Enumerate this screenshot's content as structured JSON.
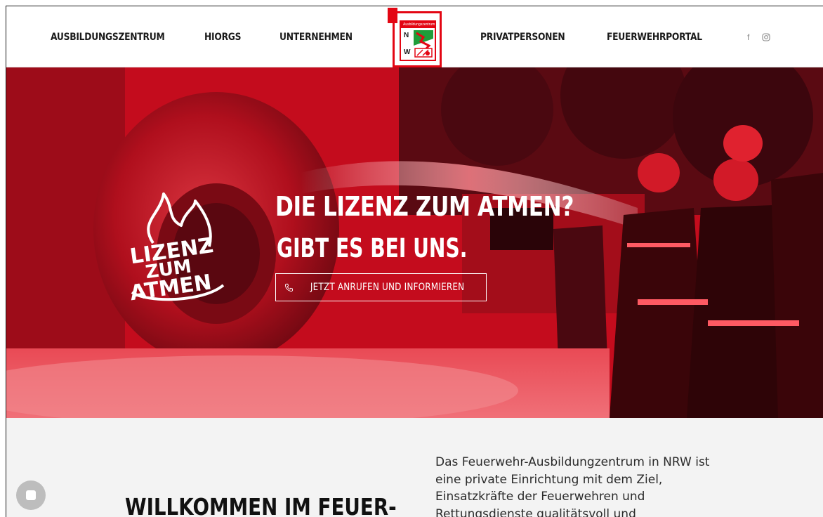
{
  "nav": {
    "left": [
      "AUSBILDUNGSZENTRUM",
      "HIORGS",
      "UNTERNEHMEN"
    ],
    "right": [
      "PRIVATPERSONEN",
      "FEUERWEHRPORTAL"
    ]
  },
  "logo": {
    "top_text": "Ausbildungszentrum",
    "letter_n": "N",
    "letter_w": "W"
  },
  "social": {
    "facebook": "f",
    "instagram_icon": "instagram-icon"
  },
  "hero": {
    "badge_lines": [
      "LIZENZ",
      "ZUM",
      "ATMEN"
    ],
    "title": "DIE LIZENZ ZUM ATMEN?",
    "subtitle": "GIBT ES BEI UNS.",
    "cta_label": "JETZT ANRUFEN UND INFORMIEREN",
    "cta_icon": "phone-icon"
  },
  "intro": {
    "heading": "WILLKOMMEN IM FEUER-",
    "text": "Das Feuerwehr-Ausbildungzentrum in NRW ist eine private Einrichtung mit dem Ziel, Einsatzkräfte der Feuerwehren und Rettungsdienste qualitätsvoll und fachgerecht"
  },
  "colors": {
    "brand_red": "#e30613",
    "hero_red": "#c40c1d",
    "text_dark": "#1a1a1a"
  }
}
